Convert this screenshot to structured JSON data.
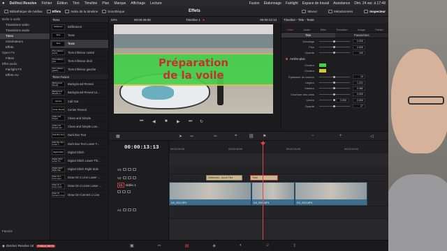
{
  "menubar": {
    "apple": "",
    "app": "DaVinci Resolve",
    "items": [
      "Fichier",
      "Édition",
      "Trim",
      "Timeline",
      "Plan",
      "Marque",
      "Affichage",
      "Lecture"
    ],
    "right_items": [
      "Fusion",
      "Étalonnage",
      "Fairlight",
      "Espace de travail",
      "Assistance"
    ],
    "clock": "Dim. 24 avr. à 17:48"
  },
  "toolbar": {
    "media_pool": "Bibliothèque de médias",
    "effects_library": "Effets",
    "edit_index": "Index de la timeline",
    "sound_library": "Sonothèque",
    "center_title": "Effets",
    "mixer": "Mixeur",
    "metadata": "Métadonnées",
    "inspector": "Inspecteur"
  },
  "left_tree": [
    {
      "label": "Boîte à outils",
      "type": "head"
    },
    {
      "label": "Transitions vidéo",
      "type": "item"
    },
    {
      "label": "Transitions audio",
      "type": "item"
    },
    {
      "label": "Titres",
      "type": "sel"
    },
    {
      "label": "Générateurs",
      "type": "item"
    },
    {
      "label": "Effets",
      "type": "item"
    },
    {
      "label": "Open FX",
      "type": "head"
    },
    {
      "label": "Filtres",
      "type": "item"
    },
    {
      "label": "Effet audio",
      "type": "head"
    },
    {
      "label": "Fairlight FX",
      "type": "item"
    },
    {
      "label": "Effets AU",
      "type": "item"
    }
  ],
  "favorites_label": "Favoris",
  "fx_list": {
    "section1": "Titres",
    "items1": [
      {
        "thumb": "Défilement",
        "label": "Défilement"
      },
      {
        "thumb": "Texte",
        "label": "Texte"
      },
      {
        "thumb": "Texte",
        "label": "Texte",
        "selected": true
      },
      {
        "thumb": "Tiers inférieur centré",
        "label": "Tiers inférieur centré"
      },
      {
        "thumb": "Tiers inférieur droit",
        "label": "Tiers inférieur droit"
      },
      {
        "thumb": "Tiers inférieur gauche",
        "label": "Tiers inférieur gauche"
      }
    ],
    "section2": "Titres Fusion",
    "items2": [
      {
        "thumb": "Background Reveal",
        "label": "Background Reveal"
      },
      {
        "thumb": "Background Reveal Lo...",
        "label": "Background Reveal Lo..."
      },
      {
        "thumb": "Call Out",
        "label": "Call Out"
      },
      {
        "thumb": "Center Reveal",
        "label": "Center Reveal"
      },
      {
        "thumb": "Clean and Simple",
        "label": "Clean and Simple"
      },
      {
        "thumb": "Clean and Simple Low...",
        "label": "Clean and Simple Low..."
      },
      {
        "thumb": "Dark Box Text",
        "label": "Dark Box Text"
      },
      {
        "thumb": "Dark Box Text Lower T...",
        "label": "Dark Box Text Lower T..."
      },
      {
        "thumb": "Digital Glitch",
        "label": "Digital Glitch"
      },
      {
        "thumb": "Digital Glitch Lower Thi...",
        "label": "Digital Glitch Lower Thi..."
      },
      {
        "thumb": "Digital Glitch Right Side",
        "label": "Digital Glitch Right Side"
      },
      {
        "thumb": "Draw On 1 Line Lower ...",
        "label": "Draw On 1 Line Lower ..."
      },
      {
        "thumb": "Draw On 2 Lines Lower ...",
        "label": "Draw On 2 Lines Lower ..."
      },
      {
        "thumb": "Draw On Corners 1 Line",
        "label": "Draw On Corners 1 Line"
      }
    ]
  },
  "viewer": {
    "zoom": "69%",
    "timecode_left": "00:00:28:08",
    "timeline_name": "Timeline 1",
    "timecode_right": "00:00:13:13",
    "title_line1": "Préparation",
    "title_line2": "de la voile"
  },
  "inspector": {
    "title": "Timeline - Title - Texte",
    "tabs": [
      "Vidéo",
      "Audio",
      "Effet",
      "Transition",
      "Image",
      "Fichier"
    ],
    "subtabs": [
      "Titre",
      "Paramètres"
    ],
    "rows_top": [
      {
        "label": "Décalage",
        "value": "0.000"
      },
      {
        "label": "Flou",
        "value": "0.000"
      },
      {
        "label": "Opacité",
        "value": "100"
      }
    ],
    "group_label": "Arrière-plan",
    "rows_bg": [
      {
        "label": "Couleur",
        "swatch": "#43d04a"
      },
      {
        "label": "Couleur",
        "swatch": "#d8c52a"
      },
      {
        "label": "Épaisseur du contour",
        "value": "13"
      },
      {
        "label": "Largeur",
        "value": "1.221"
      },
      {
        "label": "Hauteur",
        "value": "0.382"
      },
      {
        "label": "Courbure des coins",
        "value": "0.000"
      },
      {
        "label": "Centre",
        "value": "0.000",
        "value2": "0.000"
      },
      {
        "label": "Opacité",
        "value": "27"
      }
    ]
  },
  "timeline": {
    "timecode": "00:00:13:13",
    "ruler": [
      "00:00:00:00",
      "00:00:08:00",
      "00:00:16:00",
      "00:00:24:00"
    ],
    "tracks": [
      {
        "name": "V3"
      },
      {
        "name": "V2"
      },
      {
        "name": "V1",
        "label": "Vidéo 1"
      },
      {
        "name": "A1"
      }
    ],
    "title_clips": [
      "Défilement - Ancré Titre",
      "Texte"
    ],
    "video_clips": [
      "DJI_0011.MP4",
      "DJI_0009.MP4",
      "DJI_0010.MP4"
    ]
  },
  "status": {
    "app": "DaVinci Resolve 18",
    "badge": "PUBLIC BETA"
  },
  "colors": {
    "accent": "#e0434b",
    "green_band": "#43d04a",
    "outline": "#d5c34a",
    "title_text": "#c1342d"
  }
}
